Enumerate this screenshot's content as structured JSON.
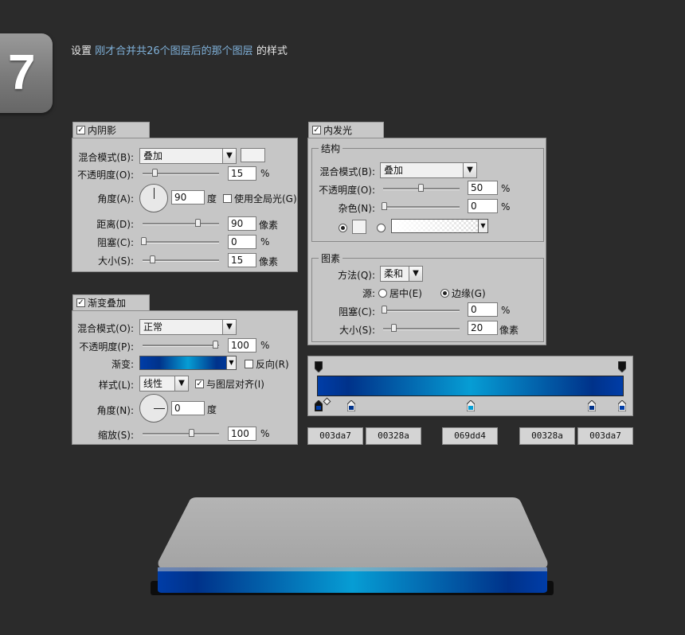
{
  "step": {
    "number": "7"
  },
  "heading": {
    "prefix": "设置 ",
    "highlight": "刚才合并共26个图层后的那个图层",
    "suffix": " 的样式"
  },
  "inner_shadow": {
    "title": "内阴影",
    "checked": true,
    "blend_mode_label": "混合模式(B):",
    "blend_mode": "叠加",
    "opacity_label": "不透明度(O):",
    "opacity": "15",
    "opacity_unit": "%",
    "angle_label": "角度(A):",
    "angle": "90",
    "angle_unit": "度",
    "global_light_label": "使用全局光(G)",
    "global_light_checked": false,
    "distance_label": "距离(D):",
    "distance": "90",
    "distance_unit": "像素",
    "choke_label": "阻塞(C):",
    "choke": "0",
    "choke_unit": "%",
    "size_label": "大小(S):",
    "size": "15",
    "size_unit": "像素"
  },
  "inner_glow": {
    "title": "内发光",
    "checked": true,
    "structure_label": "结构",
    "blend_mode_label": "混合模式(B):",
    "blend_mode": "叠加",
    "opacity_label": "不透明度(O):",
    "opacity": "50",
    "opacity_unit": "%",
    "noise_label": "杂色(N):",
    "noise": "0",
    "noise_unit": "%",
    "elements_label": "图素",
    "technique_label": "方法(Q):",
    "technique": "柔和",
    "source_label": "源:",
    "source_center": "居中(E)",
    "source_edge": "边缘(G)",
    "choke_label": "阻塞(C):",
    "choke": "0",
    "choke_unit": "%",
    "size_label": "大小(S):",
    "size": "20",
    "size_unit": "像素"
  },
  "gradient_overlay": {
    "title": "渐变叠加",
    "checked": true,
    "blend_mode_label": "混合模式(O):",
    "blend_mode": "正常",
    "opacity_label": "不透明度(P):",
    "opacity": "100",
    "opacity_unit": "%",
    "gradient_label": "渐变:",
    "reverse_label": "反向(R)",
    "style_label": "样式(L):",
    "style": "线性",
    "align_label": "与图层对齐(I)",
    "align_checked": true,
    "angle_label": "角度(N):",
    "angle": "0",
    "angle_unit": "度",
    "scale_label": "缩放(S):",
    "scale": "100",
    "scale_unit": "%"
  },
  "gradient_stops": [
    "003da7",
    "00328a",
    "069dd4",
    "00328a",
    "003da7"
  ],
  "colors": {
    "c1": "#003da7",
    "c2": "#00328a",
    "c3": "#069dd4",
    "background": "#2b2b2b"
  }
}
